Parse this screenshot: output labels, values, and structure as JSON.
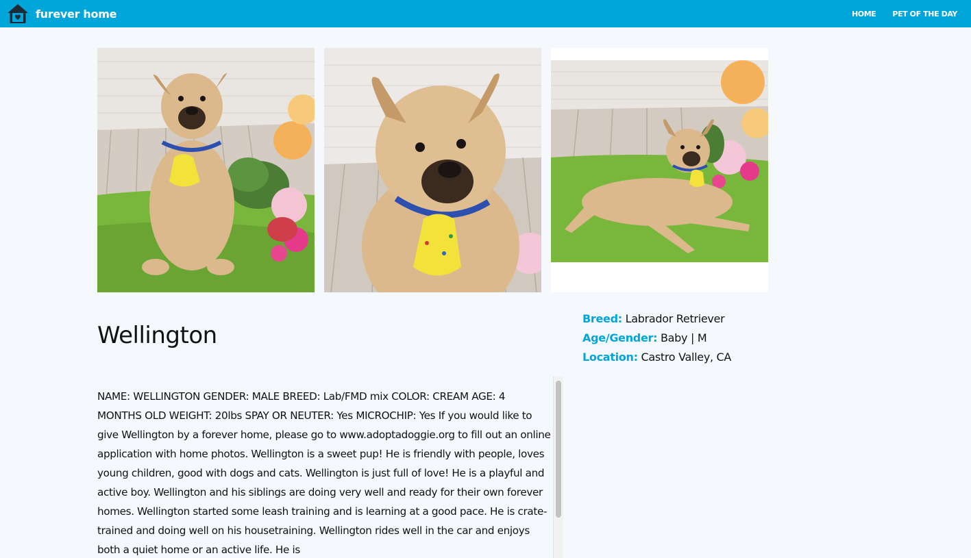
{
  "nav": {
    "brand": "furever home",
    "links": [
      "HOME",
      "PET OF THE DAY"
    ]
  },
  "colors": {
    "accent": "#00a5d9",
    "background": "#f5f9fd",
    "text": "#111111"
  },
  "pet": {
    "name": "Wellington",
    "photos": [
      "dog-sitting-photo",
      "dog-closeup-photo",
      "dog-lying-photo"
    ],
    "details": {
      "breed_label": "Breed:",
      "breed": "Labrador Retriever",
      "age_gender_label": "Age/Gender:",
      "age_gender": "Baby | M",
      "location_label": "Location:",
      "location": "Castro Valley, CA"
    },
    "description": "NAME: WELLINGTON GENDER: MALE BREED: Lab/FMD mix COLOR: CREAM AGE: 4 MONTHS OLD WEIGHT: 20lbs SPAY OR NEUTER: Yes MICROCHIP: Yes If you would like to give Wellington by a forever home, please go to www.adoptadoggie.org to fill out an online application with home photos. Wellington is a sweet pup! He is friendly with people, loves young children, good with dogs and cats. Wellington is just full of love! He is a playful and active boy. Wellington and his siblings are doing very well and ready for their own forever homes. Wellington started some leash training and is learning at a good pace. He is crate-trained and doing well on his housetraining. Wellington rides well in the car and enjoys both a quiet home or an active life. He is"
  }
}
